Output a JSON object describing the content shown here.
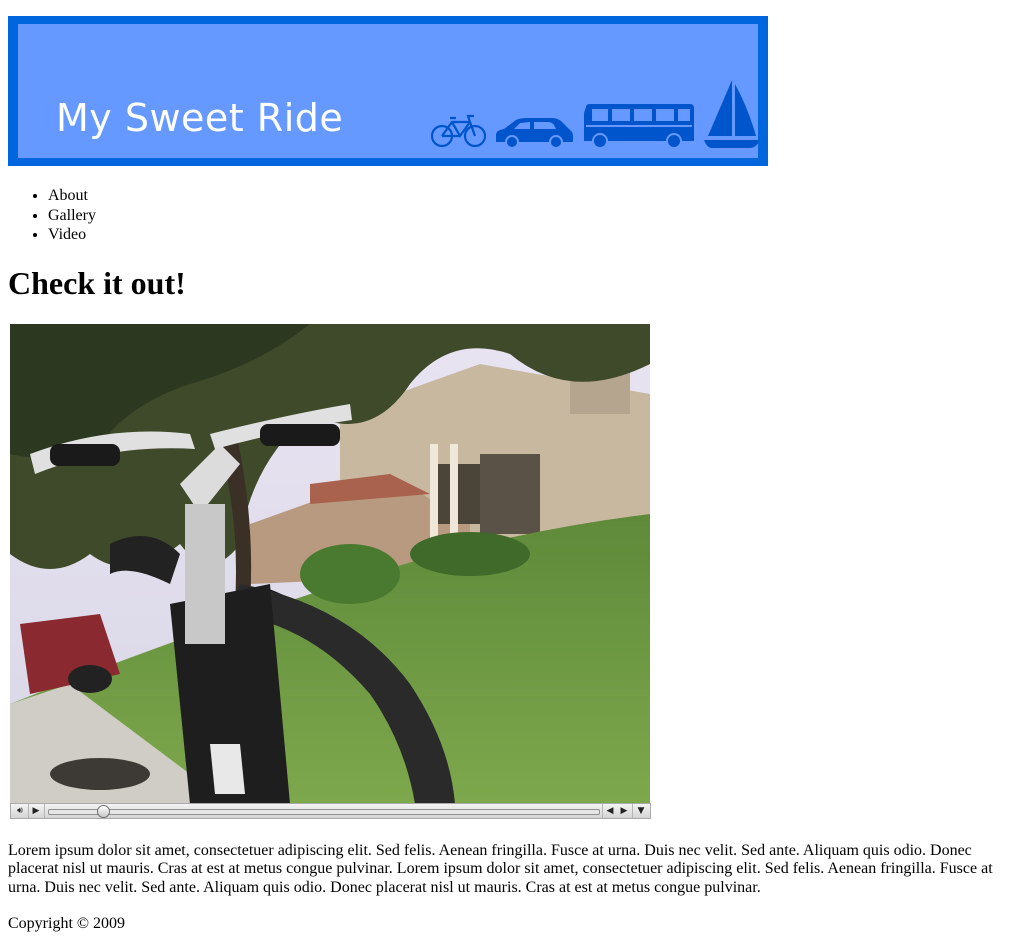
{
  "header": {
    "site_title": "My Sweet Ride",
    "icons": [
      "bicycle-icon",
      "car-icon",
      "bus-icon",
      "sailboat-icon"
    ],
    "colors": {
      "border": "#0066dd",
      "fill": "#6699ff",
      "icon": "#0055cc",
      "text": "#ffffff"
    }
  },
  "nav": {
    "items": [
      {
        "label": "About"
      },
      {
        "label": "Gallery"
      },
      {
        "label": "Video"
      }
    ]
  },
  "main": {
    "heading": "Check it out!",
    "video": {
      "progress": 0.1,
      "controls": [
        "volume-icon",
        "play-icon",
        "step-back-icon",
        "step-forward-icon",
        "menu-arrow-icon"
      ]
    },
    "paragraph": "Lorem ipsum dolor sit amet, consectetuer adipiscing elit. Sed felis. Aenean fringilla. Fusce at urna. Duis nec velit. Sed ante. Aliquam quis odio. Donec placerat nisl ut mauris. Cras at est at metus congue pulvinar. Lorem ipsum dolor sit amet, consectetuer adipiscing elit. Sed felis. Aenean fringilla. Fusce at urna. Duis nec velit. Sed ante. Aliquam quis odio. Donec placerat nisl ut mauris. Cras at est at metus congue pulvinar."
  },
  "footer": {
    "copyright": "Copyright © 2009"
  }
}
